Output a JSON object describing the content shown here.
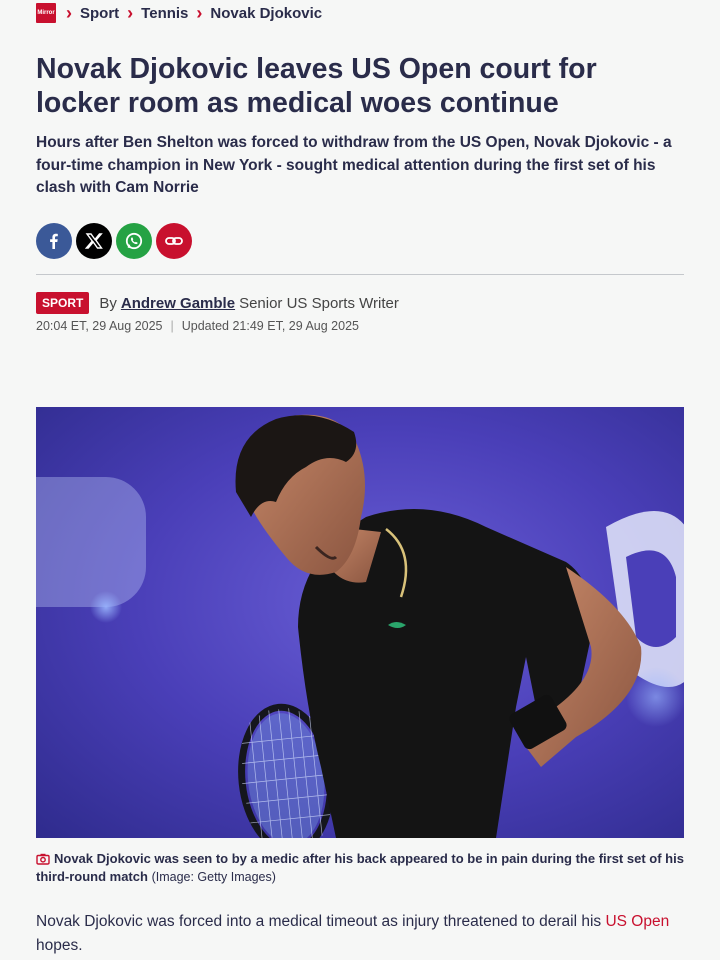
{
  "breadcrumb": {
    "logo_text": "Mirror",
    "items": [
      "Sport",
      "Tennis",
      "Novak Djokovic"
    ]
  },
  "article": {
    "headline": "Novak Djokovic leaves US Open court for locker room as medical woes continue",
    "standfirst": "Hours after Ben Shelton was forced to withdraw from the US Open, Novak Djokovic - a four-time champion in New York - sought medical attention during the first set of his clash with Cam Norrie",
    "share_icons": [
      "facebook-icon",
      "x-icon",
      "whatsapp-icon",
      "link-icon"
    ],
    "badge": "SPORT",
    "by": "By",
    "author": "Andrew Gamble",
    "author_role": "Senior US Sports Writer",
    "published": "20:04 ET, 29 Aug 2025",
    "updated": "Updated 21:49 ET, 29 Aug 2025",
    "caption": "Novak Djokovic was seen to by a medic after his back appeared to be in pain during the first set of his third-round match",
    "credit": "(Image: Getty Images)",
    "body_before": "Novak Djokovic was forced into a medical timeout as injury threatened to derail his ",
    "body_link": "US Open",
    "body_after": " hopes."
  },
  "colors": {
    "accent": "#c8102e",
    "text": "#2a2c4a",
    "background": "#f6f7f6"
  }
}
